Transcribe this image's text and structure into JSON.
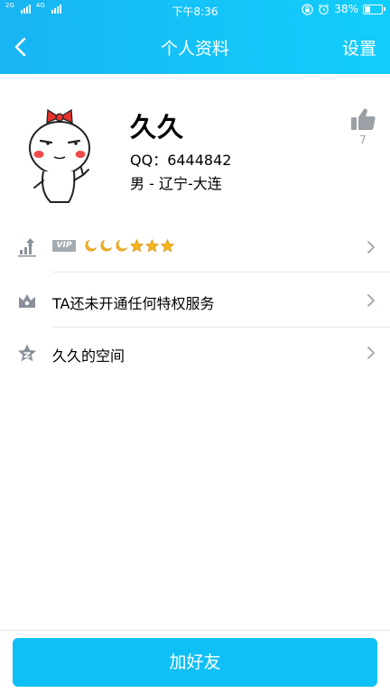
{
  "status_bar": {
    "time": "下午8:36",
    "network_1": "2G",
    "network_2": "4G",
    "battery": "38%",
    "battery_level": 0.38
  },
  "navbar": {
    "back_icon": "chevron-left-icon",
    "title": "个人资料",
    "settings_label": "设置"
  },
  "profile": {
    "name": "久久",
    "qq": "QQ：6444842",
    "location": "男 - 辽宁-大连",
    "likes": "7",
    "like_icon": "thumbs-up-icon"
  },
  "rows": {
    "level": {
      "icon": "level-up-icon",
      "vip_badge": "VIP",
      "level_icons": [
        "moon",
        "moon",
        "moon",
        "star",
        "star",
        "star"
      ]
    },
    "privilege": {
      "icon": "privilege-crown-icon",
      "label": "TA还未开通任何特权服务"
    },
    "space": {
      "icon": "qzone-star-icon",
      "label": "久久的空间"
    }
  },
  "footer": {
    "add_friend_label": "加好友"
  },
  "colors": {
    "header_start": "#18b4f3",
    "header_end": "#12cdfb",
    "button": "#0fc0f6",
    "icon_gray": "#8a9099",
    "level_gold": "#f6b51e"
  }
}
